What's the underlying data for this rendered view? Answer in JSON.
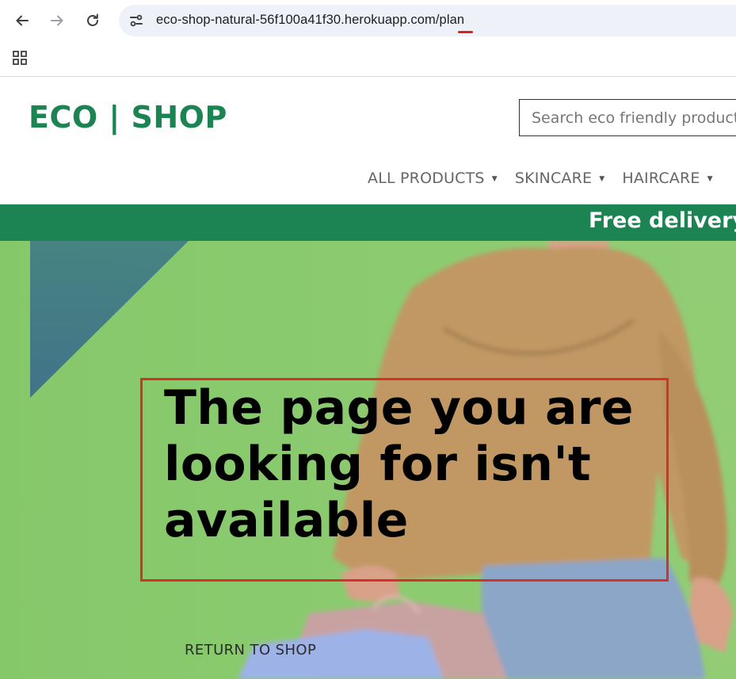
{
  "browser": {
    "url": "eco-shop-natural-56f100a41f30.herokuapp.com/plan",
    "icons": [
      "back-arrow-icon",
      "forward-arrow-icon",
      "reload-icon",
      "site-info-icon",
      "apps-grid-icon"
    ]
  },
  "header": {
    "logo": "ECO | SHOP",
    "search_placeholder": "Search eco friendly products",
    "nav": [
      {
        "label": "ALL PRODUCTS"
      },
      {
        "label": "SKINCARE"
      },
      {
        "label": "HAIRCARE"
      }
    ]
  },
  "banner": {
    "text": "Free delivery"
  },
  "hero": {
    "heading": "The page you are looking for isn't available",
    "return_link": "RETURN TO SHOP"
  },
  "colors": {
    "brand_green": "#1b8452",
    "hero_green": "#8cc96f",
    "highlight_red": "#d6302a"
  }
}
